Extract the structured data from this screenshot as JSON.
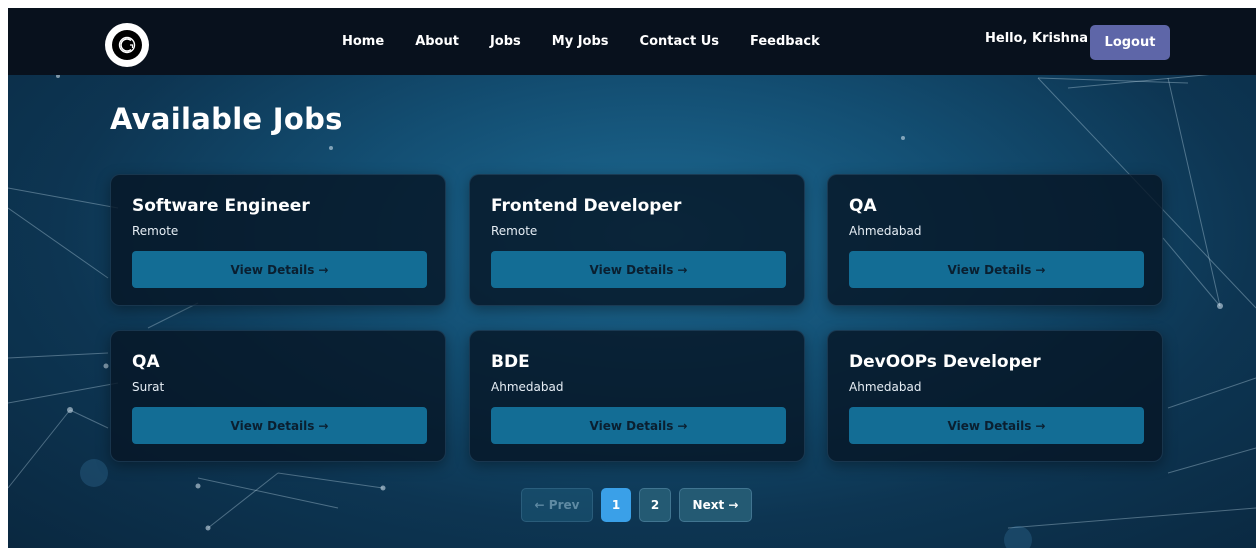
{
  "nav": {
    "links": [
      "Home",
      "About",
      "Jobs",
      "My Jobs",
      "Contact Us",
      "Feedback"
    ],
    "greeting": "Hello, Krishna",
    "logout_label": "Logout"
  },
  "page": {
    "title": "Available Jobs"
  },
  "jobs": [
    {
      "title": "Software Engineer",
      "location": "Remote",
      "action": "View Details",
      "arrow": "→"
    },
    {
      "title": "Frontend Developer",
      "location": "Remote",
      "action": "View Details",
      "arrow": "→"
    },
    {
      "title": "QA",
      "location": "Ahmedabad",
      "action": "View Details",
      "arrow": "→"
    },
    {
      "title": "QA",
      "location": "Surat",
      "action": "View Details",
      "arrow": "→"
    },
    {
      "title": "BDE",
      "location": "Ahmedabad",
      "action": "View Details",
      "arrow": "→"
    },
    {
      "title": "DevOOPs Developer",
      "location": "Ahmedabad",
      "action": "View Details",
      "arrow": "→"
    }
  ],
  "pagination": {
    "prev_label": "← Prev",
    "pages": [
      "1",
      "2"
    ],
    "current_page": "1",
    "next_label": "Next →"
  },
  "colors": {
    "navbar_bg": "#08111d",
    "logout_bg": "#5e66a8",
    "card_button_bg": "#136d95",
    "active_page_bg": "#3aa0e8"
  },
  "icons": {
    "logo": "cg-monogram-logo",
    "background": "network-lines"
  }
}
